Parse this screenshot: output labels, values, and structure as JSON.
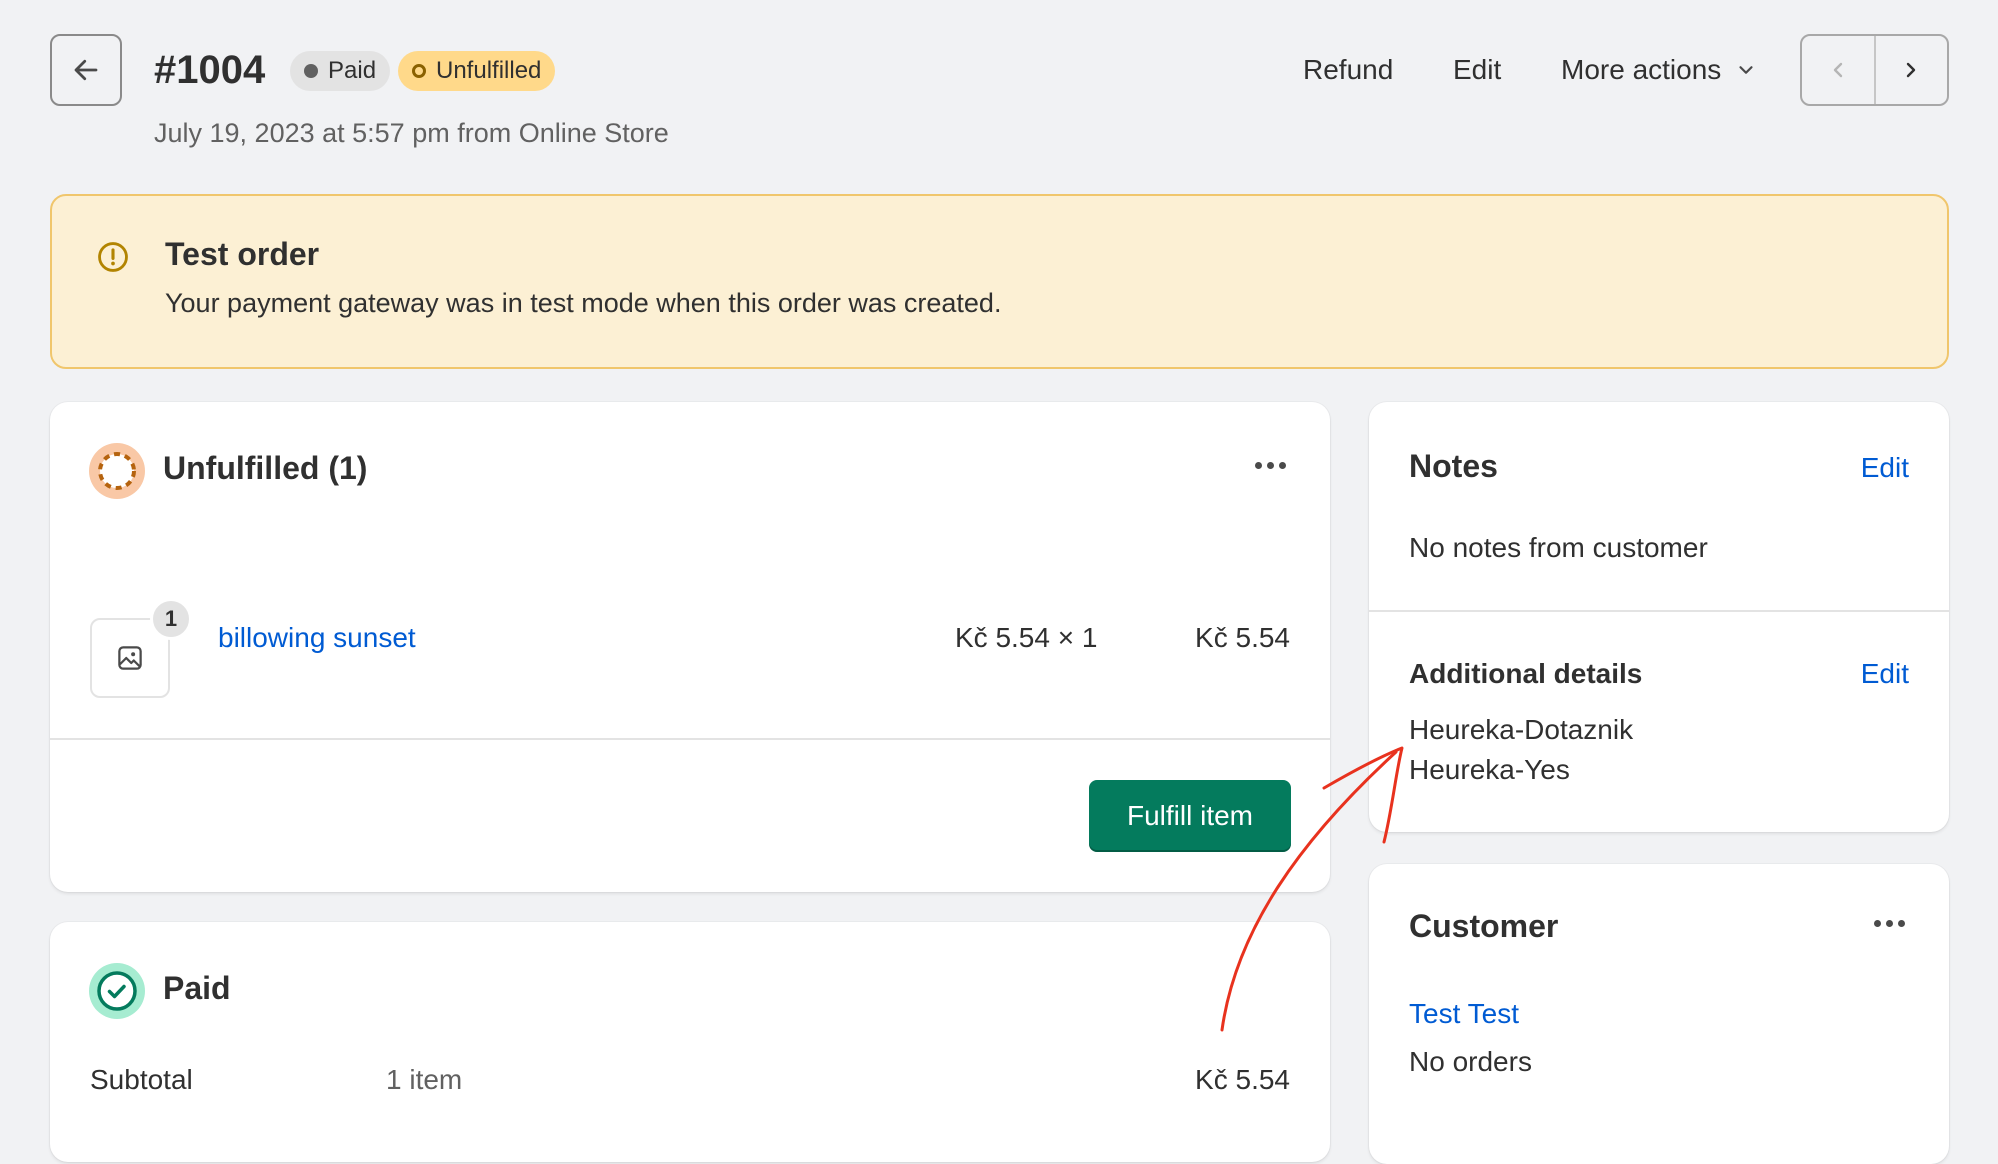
{
  "header": {
    "order_number": "#1004",
    "payment_badge": "Paid",
    "fulfillment_badge": "Unfulfilled",
    "subtitle": "July 19, 2023 at 5:57 pm from Online Store",
    "actions": {
      "refund": "Refund",
      "edit": "Edit",
      "more_actions": "More actions"
    }
  },
  "banner": {
    "title": "Test order",
    "text": "Your payment gateway was in test mode when this order was created."
  },
  "unfulfilled_card": {
    "title": "Unfulfilled (1)",
    "line_item": {
      "quantity": "1",
      "name": "billowing sunset",
      "price_qty": "Kč 5.54 × 1",
      "total": "Kč 5.54"
    },
    "fulfill_button": "Fulfill item"
  },
  "paid_card": {
    "title": "Paid",
    "subtotal_label": "Subtotal",
    "subtotal_items": "1 item",
    "subtotal_value": "Kč 5.54"
  },
  "notes_card": {
    "title": "Notes",
    "edit": "Edit",
    "empty_text": "No notes from customer",
    "additional_details": {
      "title": "Additional details",
      "edit": "Edit",
      "key": "Heureka-Dotaznik",
      "value": "Heureka-Yes"
    }
  },
  "customer_card": {
    "title": "Customer",
    "name": "Test Test",
    "orders": "No orders"
  },
  "colors": {
    "primary_green": "#047b5d",
    "link_blue": "#005bd3",
    "banner_bg": "#fcf0d4",
    "banner_border": "#f0c66c",
    "unfulfilled_badge": "#ffd98a",
    "annotation_red": "#e8321e"
  },
  "icons": {
    "back": "arrow-left-icon",
    "prev": "chevron-left-icon",
    "next": "chevron-right-icon",
    "more": "chevron-down-icon",
    "warning": "alert-circle-icon",
    "image_placeholder": "image-icon",
    "status_unfulfilled": "dashed-circle-icon",
    "status_paid": "check-circle-icon",
    "menu": "horizontal-dots-icon"
  }
}
